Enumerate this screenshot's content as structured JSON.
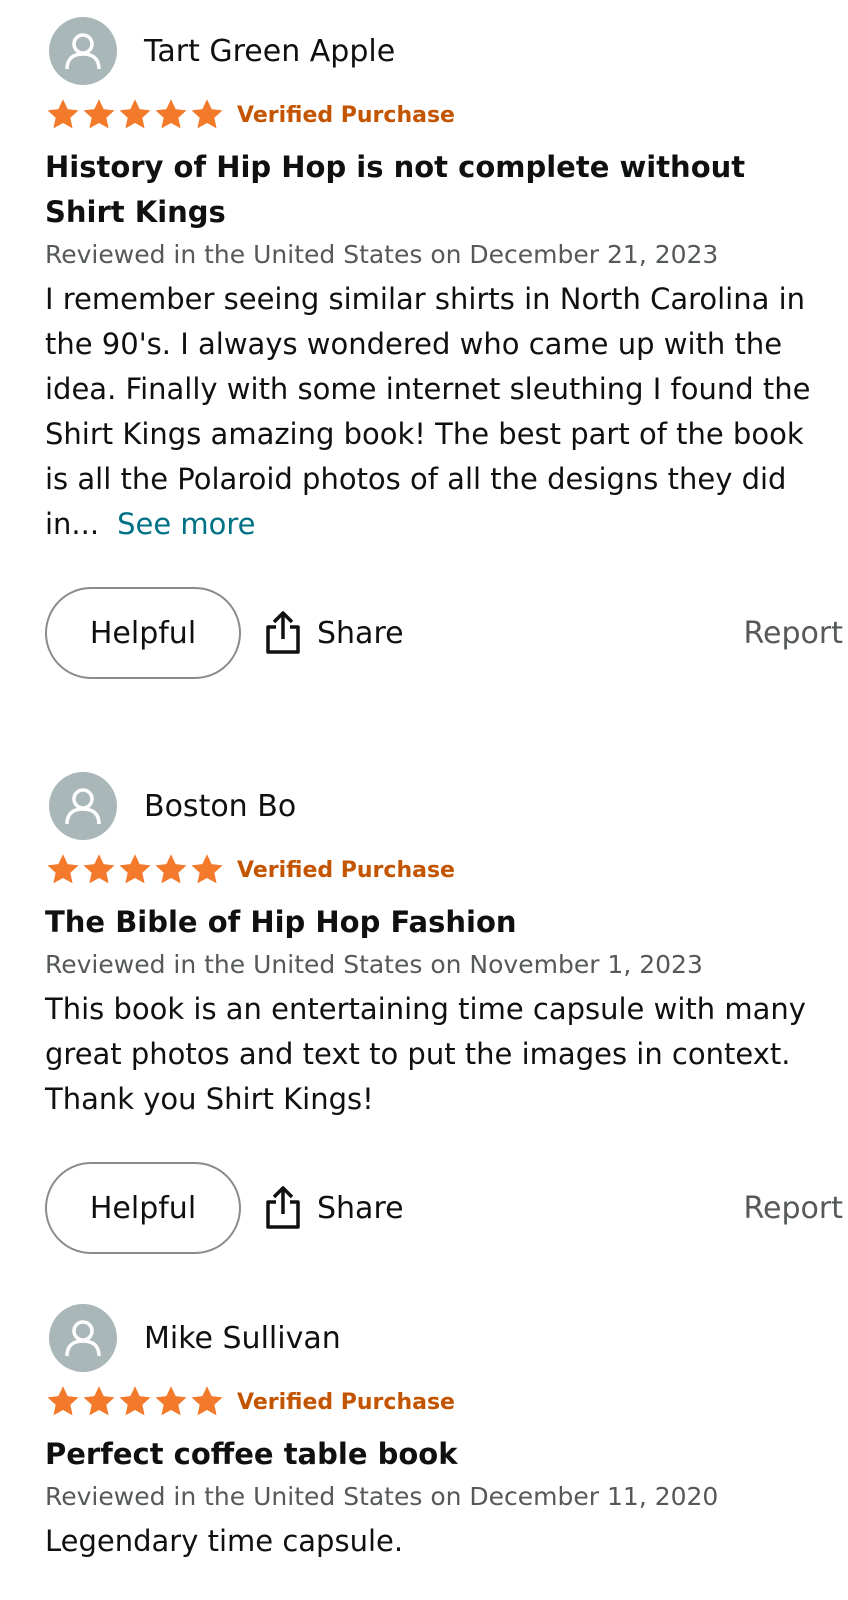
{
  "reviews": [
    {
      "reviewer": "Tart Green Apple",
      "rating": 5,
      "verified": "Verified Purchase",
      "title": "History of Hip Hop is not complete without Shirt Kings",
      "date": "Reviewed in the United States on December 21, 2023",
      "body": "I remember seeing similar shirts in North Carolina in the 90's. I always wondered who came up with the idea. Finally with some internet sleuthing I found the Shirt Kings amazing book! The best part of the book is all the Polaroid photos of all the designs they did in...",
      "see_more": "See more",
      "helpful_label": "Helpful",
      "share_label": "Share",
      "report_label": "Report"
    },
    {
      "reviewer": "Boston Bo",
      "rating": 5,
      "verified": "Verified Purchase",
      "title": "The Bible of Hip Hop Fashion",
      "date": "Reviewed in the United States on November 1, 2023",
      "body": "This book is an entertaining time capsule with many great photos and text to put the images in context. Thank you Shirt Kings!",
      "helpful_label": "Helpful",
      "share_label": "Share",
      "report_label": "Report"
    },
    {
      "reviewer": "Mike Sullivan",
      "rating": 5,
      "verified": "Verified Purchase",
      "title": "Perfect coffee table book",
      "date": "Reviewed in the United States on December 11, 2020",
      "body": "Legendary time capsule."
    }
  ],
  "colors": {
    "star": "#f3792b",
    "verified": "#c45500",
    "link": "#007185",
    "secondary_text": "#565959",
    "avatar_bg": "#aab7b8"
  },
  "icons": {
    "avatar": "person-icon",
    "star": "star-icon",
    "share": "share-icon"
  }
}
